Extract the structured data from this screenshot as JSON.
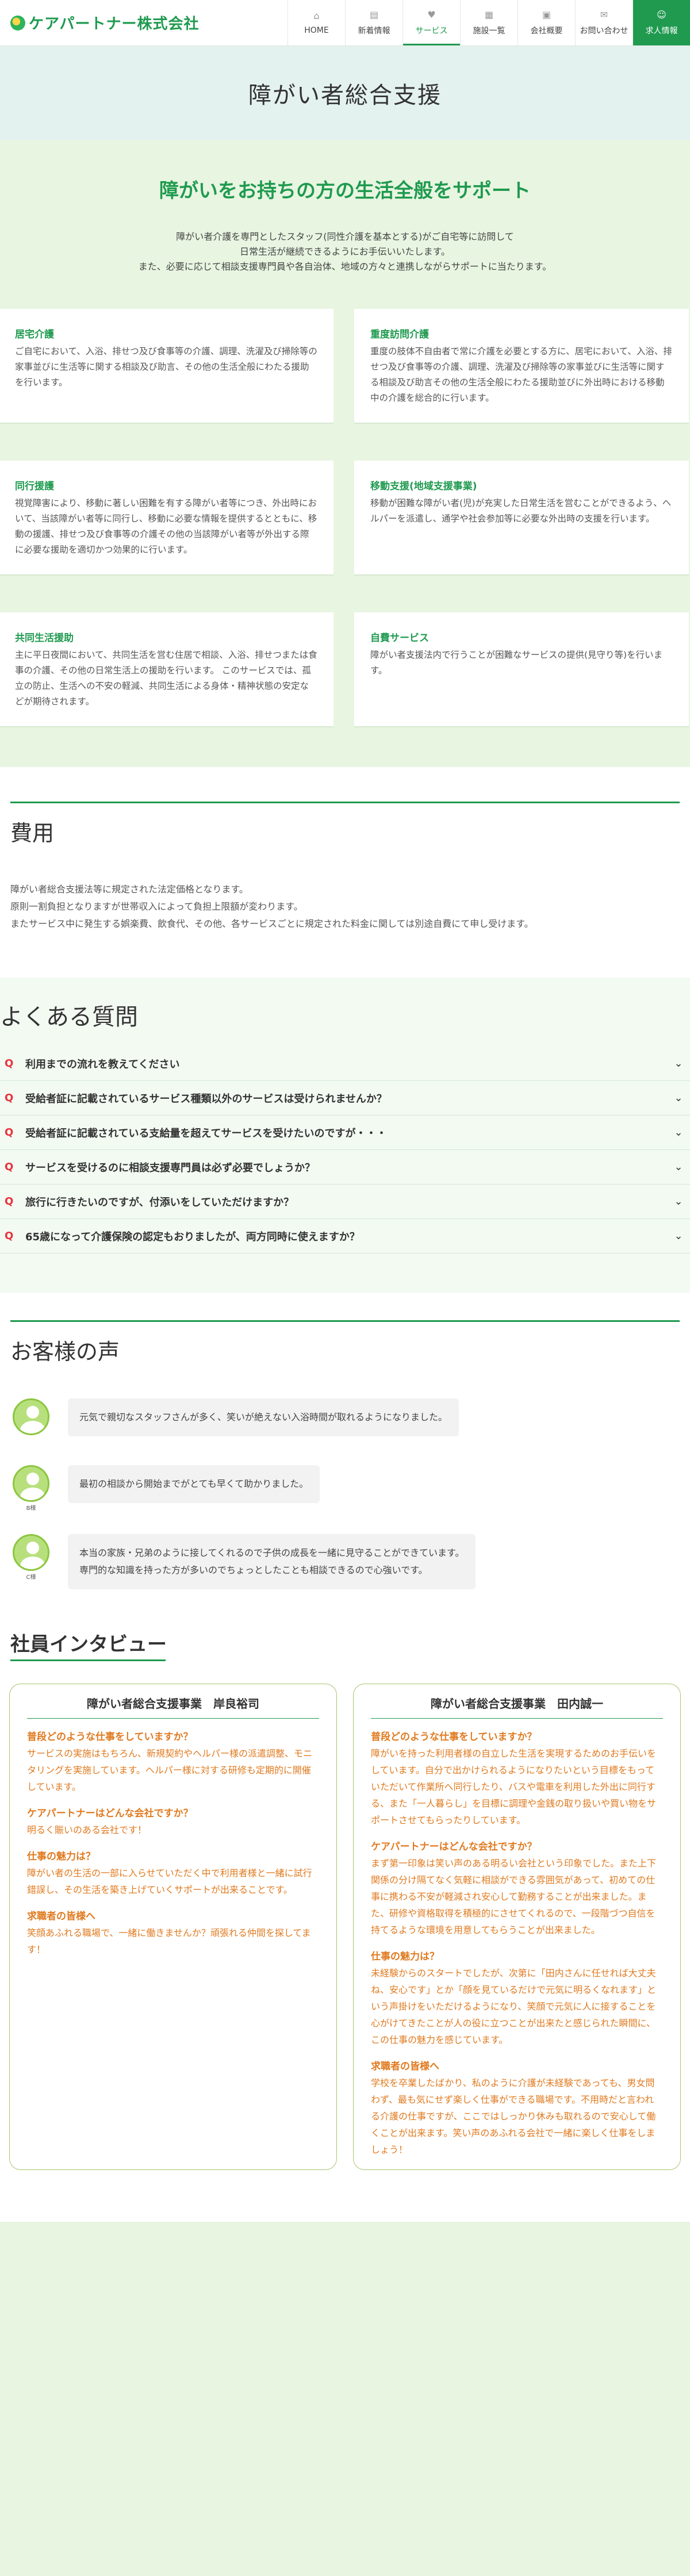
{
  "header": {
    "logo": "ケアパートナー株式会社",
    "nav": [
      {
        "label": "HOME",
        "icon": "home-icon",
        "glyph": "⌂"
      },
      {
        "label": "新着情報",
        "icon": "news-icon",
        "glyph": "▤"
      },
      {
        "label": "サービス",
        "icon": "service-icon",
        "glyph": "♥"
      },
      {
        "label": "施設一覧",
        "icon": "facility-icon",
        "glyph": "▦"
      },
      {
        "label": "会社概要",
        "icon": "company-icon",
        "glyph": "▣"
      },
      {
        "label": "お問い合わせ",
        "icon": "contact-icon",
        "glyph": "✉"
      },
      {
        "label": "求人情報",
        "icon": "recruit-icon",
        "glyph": "☺"
      }
    ]
  },
  "hero": {
    "title": "障がい者総合支援"
  },
  "support": {
    "heading": "障がいをお持ちの方の生活全般をサポート",
    "intro": [
      "障がい者介護を専門としたスタッフ(同性介護を基本とする)がご自宅等に訪問して",
      "日常生活が継続できるようにお手伝いいたします。",
      "また、必要に応じて相談支援専門員や各自治体、地域の方々と連携しながらサポートに当たります。"
    ],
    "cards": [
      {
        "title": "居宅介護",
        "body": "ご自宅において、入浴、排せつ及び食事等の介護、調理、洗濯及び掃除等の家事並びに生活等に関する相談及び助言、その他の生活全般にわたる援助を行います。"
      },
      {
        "title": "重度訪問介護",
        "body": "重度の肢体不自由者で常に介護を必要とする方に、居宅において、入浴、排せつ及び食事等の介護、調理、洗濯及び掃除等の家事並びに生活等に関する相談及び助言その他の生活全般にわたる援助並びに外出時における移動中の介護を総合的に行います。"
      },
      {
        "title": "同行援護",
        "body": "視覚障害により、移動に著しい困難を有する障がい者等につき、外出時において、当該障がい者等に同行し、移動に必要な情報を提供するとともに、移動の援護、排せつ及び食事等の介護その他の当該障がい者等が外出する際に必要な援助を適切かつ効果的に行います。"
      },
      {
        "title": "移動支援(地域支援事業)",
        "body": "移動が困難な障がい者(児)が充実した日常生活を営むことができるよう、ヘルパーを派遣し、通学や社会参加等に必要な外出時の支援を行います。"
      },
      {
        "title": "共同生活援助",
        "body": "主に平日夜間において、共同生活を営む住居で相談、入浴、排せつまたは食事の介護、その他の日常生活上の援助を行います。 このサービスでは、孤立の防止、生活への不安の軽減、共同生活による身体・精神状態の安定などが期待されます。"
      },
      {
        "title": "自費サービス",
        "body": "障がい者支援法内で行うことが困難なサービスの提供(見守り等)を行います。"
      }
    ]
  },
  "fee": {
    "heading": "費用",
    "lines": [
      "障がい者総合支援法等に規定された法定価格となります。",
      "原則一割負担となりますが世帯収入によって負担上限額が変わります。",
      "またサービス中に発生する娯楽費、飲食代、その他、各サービスごとに規定された料金に関しては別途自費にて申し受けます。"
    ]
  },
  "faq": {
    "heading": "よくある質問",
    "marker": "Q",
    "items": [
      "利用までの流れを教えてください",
      "受給者証に記載されているサービス種類以外のサービスは受けられませんか？",
      "受給者証に記載されている支給量を超えてサービスを受けたいのですが・・・",
      "サービスを受けるのに相談支援専門員は必ず必要でしょうか？",
      "旅行に行きたいのですが、付添いをしていただけますか？",
      "65歳になって介護保険の認定もおりましたが、両方同時に使えますか？"
    ]
  },
  "voices": {
    "heading": "お客様の声",
    "items": [
      {
        "who": "",
        "text": [
          "元気で親切なスタッフさんが多く、笑いが絶えない入浴時間が取れるようになりました。"
        ]
      },
      {
        "who": "B様",
        "text": [
          "最初の相談から開始までがとても早くて助かりました。"
        ]
      },
      {
        "who": "C様",
        "text": [
          "本当の家族・兄弟のように接してくれるので子供の成長を一緒に見守ることができています。",
          "専門的な知識を持った方が多いのでちょっとしたことも相談できるので心強いです。"
        ]
      }
    ]
  },
  "staff": {
    "heading": "社員インタビュー",
    "cards": [
      {
        "title": "障がい者総合支援事業　岸良裕司",
        "blocks": [
          {
            "q": "普段どのような仕事をしていますか？",
            "a": "サービスの実施はもちろん、新規契約やヘルパー様の派遣調整、モニタリングを実施しています。ヘルパー様に対する研修も定期的に開催しています。"
          },
          {
            "q": "ケアパートナーはどんな会社ですか？",
            "a": "明るく賑いのある会社です！"
          },
          {
            "q": "仕事の魅力は？",
            "a": "障がい者の生活の一部に入らせていただく中で利用者様と一緒に試行錯誤し、その生活を築き上げていくサポートが出来ることです。"
          },
          {
            "q": "求職者の皆様へ",
            "a": "笑顔あふれる職場で、一緒に働きませんか？頑張れる仲間を探してます！"
          }
        ]
      },
      {
        "title": "障がい者総合支援事業　田内誠一",
        "blocks": [
          {
            "q": "普段どのような仕事をしていますか？",
            "a": "障がいを持った利用者様の自立した生活を実現するためのお手伝いをしています。自分で出かけられるようになりたいという目標をもっていただいて作業所へ同行したり、バスや電車を利用した外出に同行する、また「一人暮らし」を目標に調理や金銭の取り扱いや買い物をサポートさせてもらったりしています。"
          },
          {
            "q": "ケアパートナーはどんな会社ですか？",
            "a": "まず第一印象は笑い声のある明るい会社という印象でした。また上下関係の分け隔てなく気軽に相談ができる雰囲気があって、初めての仕事に携わる不安が軽減され安心して勤務することが出来ました。また、研修や資格取得を積極的にさせてくれるので、一段階づつ自信を持てるような環境を用意してもらうことが出来ました。"
          },
          {
            "q": "仕事の魅力は？",
            "a": "未経験からのスタートでしたが、次第に「田内さんに任せれば大丈夫ね、安心です」とか「顔を見ているだけで元気に明るくなれます」という声掛けをいただけるようになり、笑顔で元気に人に接することを心がけてきたことが人の役に立つことが出来たと感じられた瞬間に、この仕事の魅力を感じています。"
          },
          {
            "q": "求職者の皆様へ",
            "a": "学校を卒業したばかり、私のように介護が未経験であっても、男女問わず、最も気にせず楽しく仕事ができる職場です。不用時だと言われる介護の仕事ですが、ここではしっかり休みも取れるので安心して働くことが出来ます。笑い声のあふれる会社で一緒に楽しく仕事をしましょう！"
          }
        ]
      }
    ]
  }
}
